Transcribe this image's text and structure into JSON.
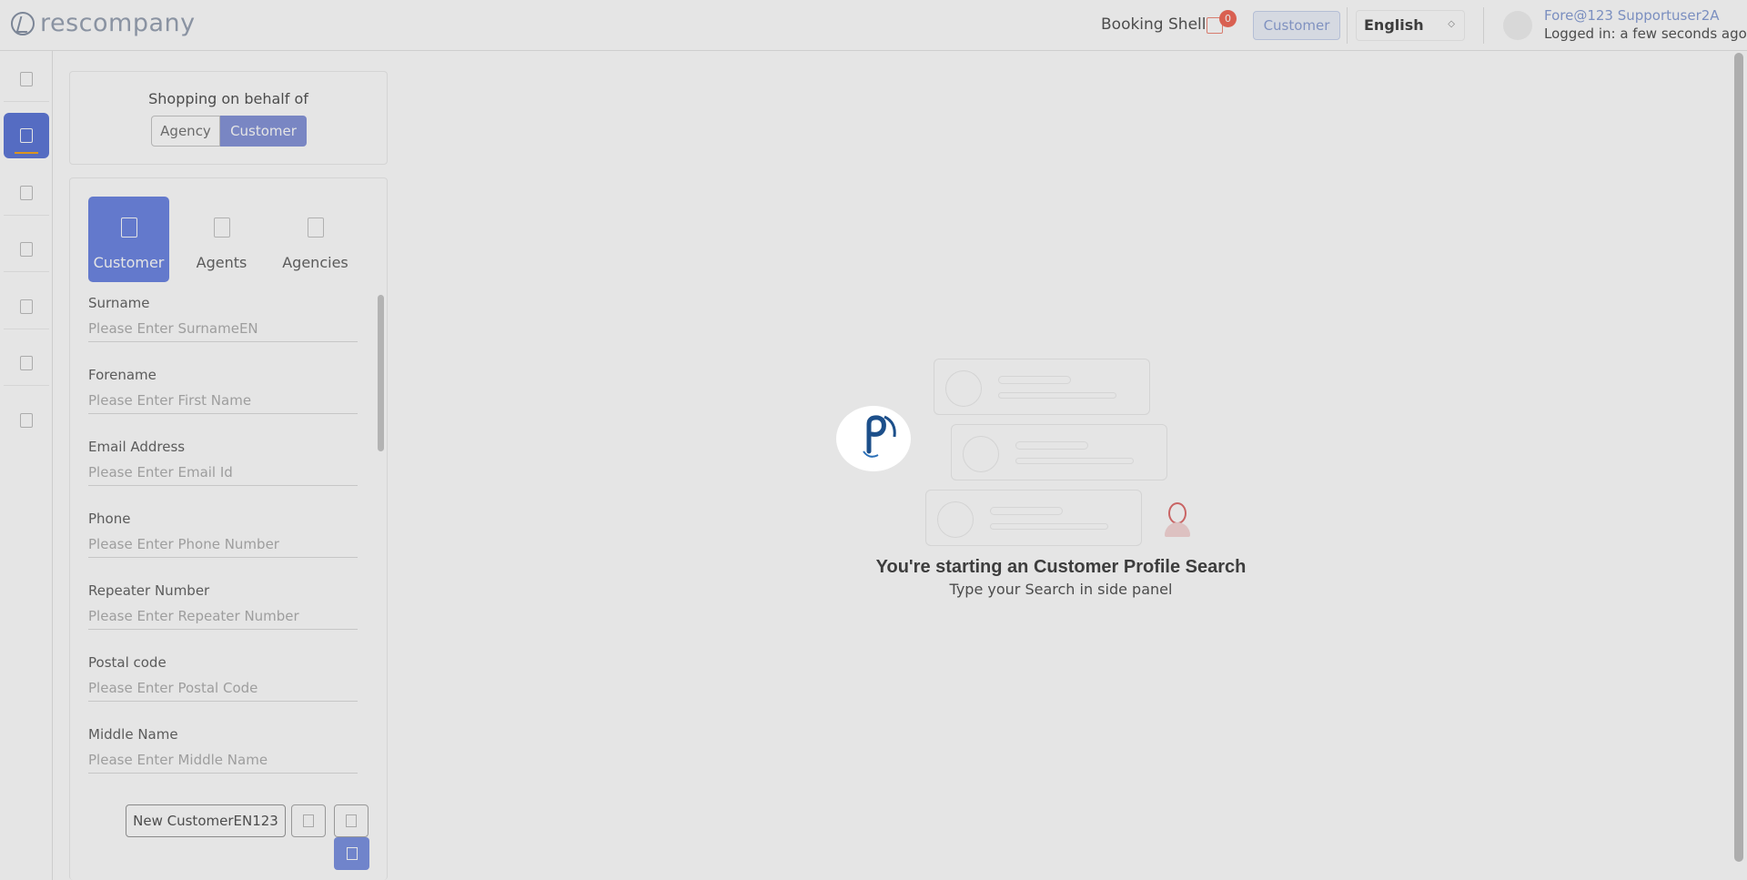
{
  "header": {
    "logo_text": "rescompany",
    "booking_shell": "Booking Shell",
    "cart_count": "0",
    "customer_chip": "Customer",
    "language": "English",
    "user_name": "Fore@123 Supportuser2A",
    "logged_in": "Logged in: a few seconds ago"
  },
  "behalf": {
    "title": "Shopping on behalf of",
    "options": [
      "Agency",
      "Customer"
    ],
    "selected": "Customer"
  },
  "search_tabs": [
    {
      "label": "Customer",
      "active": true,
      "icon": "user-icon"
    },
    {
      "label": "Agents",
      "active": false,
      "icon": "agent-icon"
    },
    {
      "label": "Agencies",
      "active": false,
      "icon": "building-icon"
    }
  ],
  "fields": [
    {
      "label": "Surname",
      "placeholder": "Please Enter SurnameEN"
    },
    {
      "label": "Forename",
      "placeholder": "Please Enter First Name"
    },
    {
      "label": "Email Address",
      "placeholder": "Please Enter Email Id"
    },
    {
      "label": "Phone",
      "placeholder": "Please Enter Phone Number"
    },
    {
      "label": "Repeater Number",
      "placeholder": "Please Enter Repeater Number"
    },
    {
      "label": "Postal code",
      "placeholder": "Please Enter Postal Code"
    },
    {
      "label": "Middle Name",
      "placeholder": "Please Enter Middle Name"
    }
  ],
  "actions": {
    "new_customer": "New CustomerEN123"
  },
  "empty_state": {
    "title": "You're starting an Customer Profile Search",
    "subtitle": "Type your Search in side panel"
  },
  "colors": {
    "accent": "#6f87e4",
    "badge": "#f26b5b",
    "rail_active_underline": "#f5a623"
  }
}
